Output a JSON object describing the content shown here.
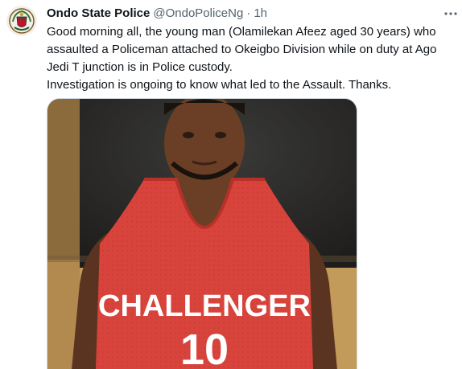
{
  "tweet": {
    "author_name": "Ondo State Police",
    "author_handle": "@OndoPoliceNg",
    "separator": "·",
    "time": "1h",
    "more_icon": "more-horizontal-icon",
    "avatar_icon": "police-crest-icon",
    "text_lines": [
      "Good morning all, the young man (Olamilekan Afeez aged 30 years) who assaulted a Policeman attached to Okeigbo Division while on duty at Ago Jedi T junction is in Police custody.",
      "Investigation is ongoing to know what led to the Assault. Thanks."
    ],
    "photo": {
      "jersey_text": "CHALLENGER",
      "jersey_number": "10",
      "jersey_color": "#d8443c",
      "skin_color": "#6b3f26",
      "wall_color": "#b28a4f"
    }
  }
}
